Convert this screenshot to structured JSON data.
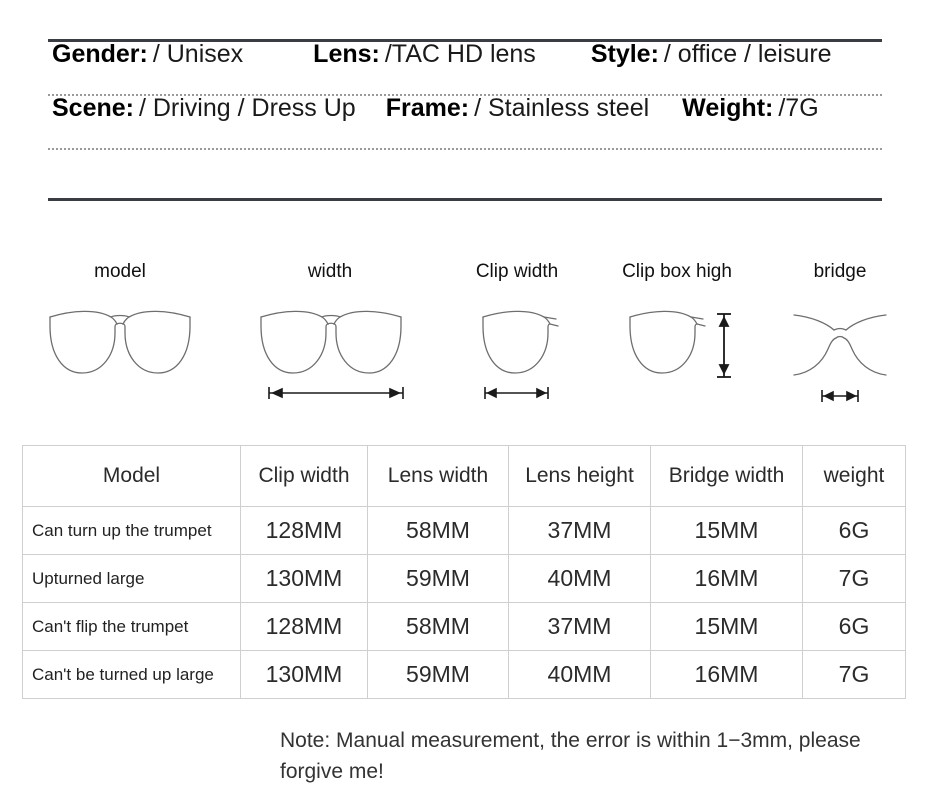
{
  "specs": {
    "row1": [
      {
        "label": "Gender:",
        "value": "/ Unisex"
      },
      {
        "label": "Lens:",
        "value": "/TAC HD lens"
      },
      {
        "label": "Style:",
        "value": "/ office / leisure"
      }
    ],
    "row2": [
      {
        "label": "Scene:",
        "value": "/ Driving / Dress Up"
      },
      {
        "label": "Frame:",
        "value": "/ Stainless steel"
      },
      {
        "label": "Weight:",
        "value": "/7G"
      }
    ]
  },
  "diagrams": [
    {
      "label": "model",
      "icon": "eyeglasses-front-icon",
      "measure": "none"
    },
    {
      "label": "width",
      "icon": "eyeglasses-front-icon",
      "measure": "horizontal-arrow"
    },
    {
      "label": "Clip width",
      "icon": "single-lens-icon",
      "measure": "horizontal-arrow"
    },
    {
      "label": "Clip box high",
      "icon": "single-lens-icon",
      "measure": "vertical-arrow"
    },
    {
      "label": "bridge",
      "icon": "nose-bridge-icon",
      "measure": "horizontal-arrow"
    }
  ],
  "table": {
    "headers": [
      "Model",
      "Clip width",
      "Lens width",
      "Lens height",
      "Bridge width",
      "weight"
    ],
    "rows": [
      {
        "model": "Can turn up the trumpet",
        "clip_width": "128MM",
        "lens_width": "58MM",
        "lens_height": "37MM",
        "bridge_width": "15MM",
        "weight": "6G"
      },
      {
        "model": "Upturned large",
        "clip_width": "130MM",
        "lens_width": "59MM",
        "lens_height": "40MM",
        "bridge_width": "16MM",
        "weight": "7G"
      },
      {
        "model": "Can't flip the trumpet",
        "clip_width": "128MM",
        "lens_width": "58MM",
        "lens_height": "37MM",
        "bridge_width": "15MM",
        "weight": "6G"
      },
      {
        "model": "Can't be turned up large",
        "clip_width": "130MM",
        "lens_width": "59MM",
        "lens_height": "40MM",
        "bridge_width": "16MM",
        "weight": "7G"
      }
    ]
  },
  "note": "Note: Manual measurement, the error is within 1−3mm, please forgive me!",
  "colors": {
    "rule": "#3a3d44",
    "dotted_rule": "#9a9a9a",
    "table_border": "#cfcfcf",
    "diagram_stroke": "#6e6e6e",
    "arrow": "#1a1a1a"
  }
}
